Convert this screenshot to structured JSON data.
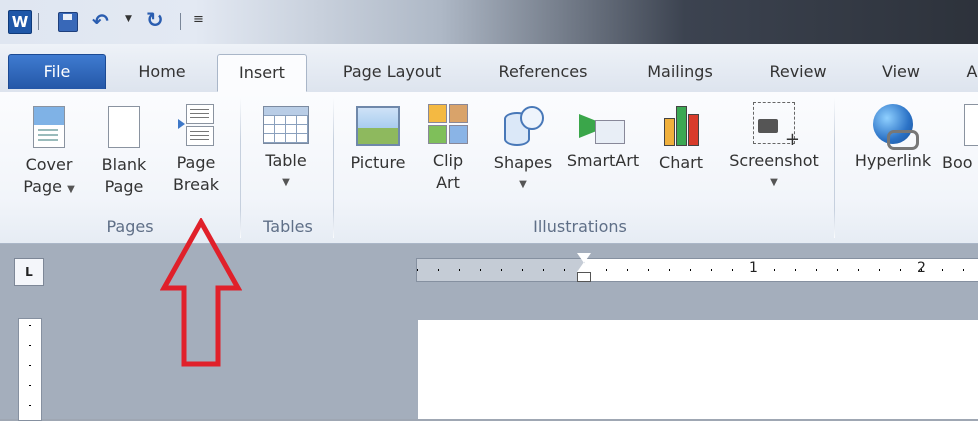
{
  "qat": {
    "word_icon_letter": "W"
  },
  "tabs": {
    "file": "File",
    "items": [
      "Home",
      "Insert",
      "Page Layout",
      "References",
      "Mailings",
      "Review",
      "View",
      "A"
    ]
  },
  "ribbon": {
    "buttons": {
      "cover_page": {
        "line1": "Cover",
        "line2": "Page"
      },
      "blank_page": {
        "line1": "Blank",
        "line2": "Page"
      },
      "page_break": {
        "line1": "Page",
        "line2": "Break"
      },
      "table": {
        "line1": "Table"
      },
      "picture": {
        "line1": "Picture"
      },
      "clip_art": {
        "line1": "Clip",
        "line2": "Art"
      },
      "shapes": {
        "line1": "Shapes"
      },
      "smartart": {
        "line1": "SmartArt"
      },
      "chart": {
        "line1": "Chart"
      },
      "screenshot": {
        "line1": "Screenshot"
      },
      "hyperlink": {
        "line1": "Hyperlink"
      },
      "bookmark": {
        "line1": "Boo"
      }
    },
    "groups": {
      "pages": "Pages",
      "tables": "Tables",
      "illustrations": "Illustrations"
    }
  },
  "ruler": {
    "ruler_button": "L",
    "numbers": [
      "1",
      "2"
    ]
  },
  "colors": {
    "file_tab": "#2457a7",
    "annotation_arrow": "#e0202a"
  }
}
